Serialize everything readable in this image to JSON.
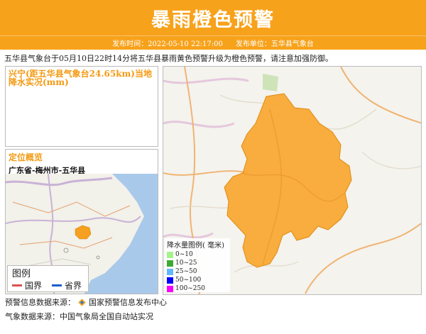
{
  "header": {
    "title": "暴雨橙色预警"
  },
  "subbar": {
    "time_label": "发布时间：2022-05-10 22:17:00",
    "unit_label": "发布单位：五华县气象台"
  },
  "description": "五华县气象台于05月10日22时14分将五华县暴雨黄色预警升级为橙色预警，请注意加强防御。",
  "rain_panel": {
    "title": "兴宁(距五华县气象台24.65km)当地降水实况(mm)"
  },
  "location_panel": {
    "title": "定位概览",
    "path": "广东省-梅州市-五华县"
  },
  "small_legend": {
    "title": "图例",
    "national": "国界",
    "provincial": "省界",
    "national_color": "#d9534f",
    "provincial_color": "#1f5fc9"
  },
  "rain_legend": {
    "title": "降水量图例( 毫米)",
    "items": [
      {
        "label": "0~10",
        "color": "#a6f28f"
      },
      {
        "label": "10~25",
        "color": "#3da935"
      },
      {
        "label": "25~50",
        "color": "#61b8ff"
      },
      {
        "label": "50~100",
        "color": "#0000fe"
      },
      {
        "label": "100~250",
        "color": "#fa00fa"
      }
    ]
  },
  "footer": {
    "warning_source": "预警信息数据来源：",
    "warning_source_name": "国家预警信息发布中心",
    "weather_source": "气象数据来源：中国气象局全国自动站实况"
  },
  "colors": {
    "brand_orange": "#f7a21b",
    "county_fill": "#f8a52a"
  }
}
